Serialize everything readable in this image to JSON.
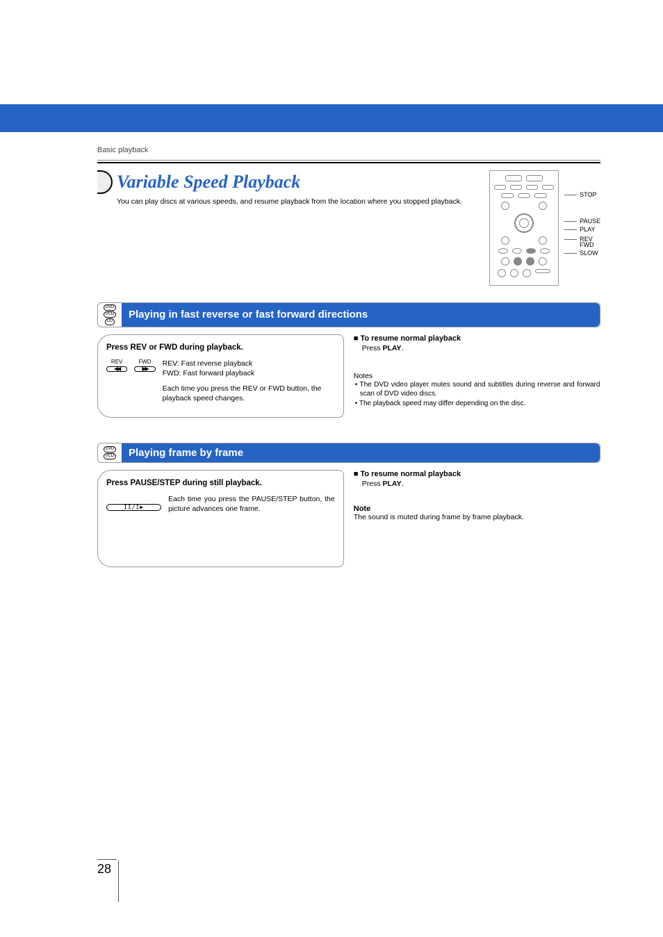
{
  "breadcrumb": "Basic playback",
  "page_title": "Variable Speed Playback",
  "intro": "You can play discs at various speeds, and resume playback from the location where you stopped playback.",
  "remote_labels": {
    "stop": "STOP",
    "pause": "PAUSE",
    "play": "PLAY",
    "rev": "REV",
    "fwd": "FWD",
    "slow": "SLOW"
  },
  "section1": {
    "disc_icons": [
      "DVD",
      "VCD",
      "CD"
    ],
    "title": "Playing in fast reverse or fast forward directions",
    "panel_title": "Press REV or FWD during playback.",
    "btn_rev_label": "REV",
    "btn_fwd_label": "FWD",
    "desc_line1": "REV:  Fast reverse playback",
    "desc_line2": "FWD: Fast forward playback",
    "desc_line3": "Each time you press the REV or FWD button, the playback speed changes.",
    "resume_head": "To resume normal playback",
    "resume_line_pre": "Press ",
    "resume_line_bold": "PLAY",
    "resume_line_post": ".",
    "notes_title": "Notes",
    "note1": "The DVD video player mutes sound and subtitles during reverse and forward scan of DVD video discs.",
    "note2": "The playback speed may differ depending on the disc."
  },
  "section2": {
    "disc_icons": [
      "DVD",
      "VCD"
    ],
    "title": "Playing frame by frame",
    "panel_title": "Press PAUSE/STEP during still playback.",
    "desc": "Each time you press the PAUSE/STEP button, the picture advances one frame.",
    "resume_head": "To resume normal playback",
    "resume_line_pre": "Press ",
    "resume_line_bold": "PLAY",
    "resume_line_post": ".",
    "note_title": "Note",
    "note": "The sound is muted during frame by frame playback."
  },
  "page_number": "28"
}
